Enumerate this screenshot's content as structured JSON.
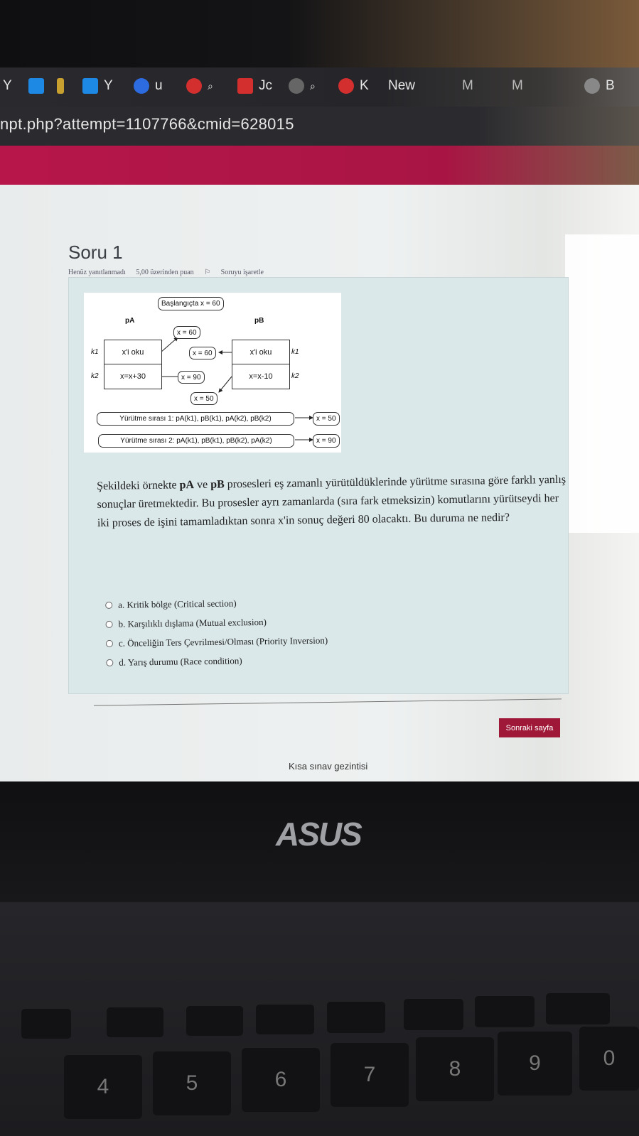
{
  "browser": {
    "tabs": [
      {
        "label": "Y",
        "color": "#2a2a2e"
      },
      {
        "label": "",
        "color": "#1e88e5"
      },
      {
        "label": "",
        "color": "#c8a030"
      },
      {
        "label": "Y",
        "color": "#1e88e5"
      },
      {
        "label": "u",
        "color": "#2d6be0"
      },
      {
        "label": "",
        "color": "#d32f2f"
      },
      {
        "label": "Jc",
        "color": "#d32f2f"
      },
      {
        "label": "",
        "color": "#666666"
      },
      {
        "label": "K",
        "color": "#d32f2f"
      },
      {
        "label": "New",
        "color": "#444444"
      },
      {
        "label": "M",
        "color": "#555555"
      },
      {
        "label": "M",
        "color": "#555555"
      },
      {
        "label": "B",
        "color": "#666666"
      }
    ],
    "url": "npt.php?attempt=1107766&cmid=628015"
  },
  "question": {
    "title": "Soru 1",
    "status": "Henüz yanıtlanmadı",
    "points": "5,00 üzerinden puan",
    "flag": "Soruyu işaretle",
    "figure": {
      "start": "Başlangıçta x = 60",
      "pa": "pA",
      "pb": "pB",
      "k1": "k1",
      "k2": "k2",
      "pa_k1": "x'i oku",
      "pa_k2": "x=x+30",
      "pb_k1": "x'i oku",
      "pb_k2": "x=x-10",
      "v_x60_a": "x = 60",
      "v_x60_b": "x = 60",
      "v_x90": "x = 90",
      "v_x50": "x = 50",
      "order1": "Yürütme sırası 1: pA(k1),   pB(k1),   pA(k2),   pB(k2)",
      "order2": "Yürütme sırası 2: pA(k1),   pB(k1),   pB(k2),   pA(k2)",
      "res1": "x = 50",
      "res2": "x = 90"
    },
    "text_parts": {
      "p1": "Şekildeki örnekte ",
      "pa": "pA",
      "p2": " ve ",
      "pb": "pB",
      "p3": " prosesleri eş zamanlı yürütüldüklerinde yürütme sırasına göre farklı yanlış sonuçlar üretmektedir. Bu prosesler ayrı zamanlarda (sıra fark etmeksizin) komutlarını yürütseydi her iki proses de işini tamamladıktan sonra x'in sonuç değeri 80 olacaktı. Bu duruma ne nedir?"
    },
    "options": [
      "a. Kritik bölge (Critical section)",
      "b. Karşılıklı dışlama (Mutual exclusion)",
      "c. Önceliğin Ters Çevrilmesi/Olması (Priority Inversion)",
      "d. Yarış durumu (Race condition)"
    ]
  },
  "next_button": "Sonraki sayfa",
  "nav_title": "Kısa sınav gezintisi",
  "laptop": {
    "brand": "ASUS",
    "keys": [
      "4",
      "5",
      "6",
      "7",
      "8",
      "9",
      "0"
    ]
  }
}
